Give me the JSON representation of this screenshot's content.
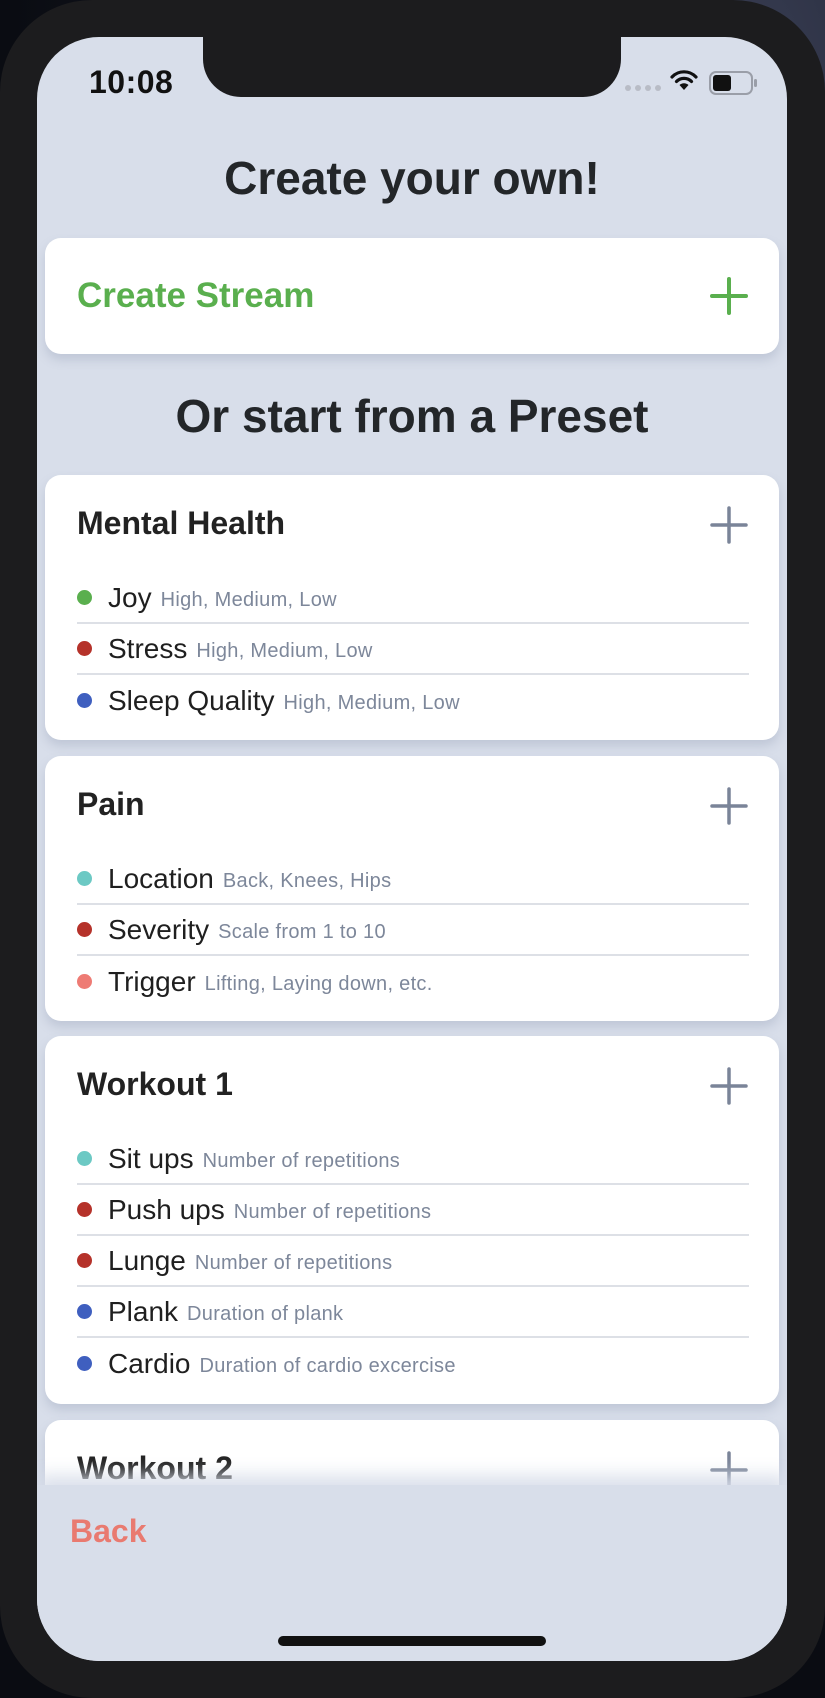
{
  "status_bar": {
    "time": "10:08"
  },
  "header": {
    "title": "Create your own!"
  },
  "create_stream": {
    "label": "Create Stream"
  },
  "presets_heading": "Or start from a Preset",
  "colors": {
    "green": "#5aaf4e",
    "red": "#b5322a",
    "blue": "#3f5fbf",
    "teal": "#6cc9c4",
    "salmon": "#ee7b74",
    "plus_gray": "#7a8498",
    "back_red": "#e97a70"
  },
  "presets": [
    {
      "title": "Mental Health",
      "items": [
        {
          "name": "Joy",
          "desc": "High, Medium, Low",
          "color": "#5aaf4e"
        },
        {
          "name": "Stress",
          "desc": "High, Medium, Low",
          "color": "#b5322a"
        },
        {
          "name": "Sleep Quality",
          "desc": "High, Medium, Low",
          "color": "#3f5fbf"
        }
      ]
    },
    {
      "title": "Pain",
      "items": [
        {
          "name": "Location",
          "desc": "Back, Knees, Hips",
          "color": "#6cc9c4"
        },
        {
          "name": "Severity",
          "desc": "Scale from 1 to 10",
          "color": "#b5322a"
        },
        {
          "name": "Trigger",
          "desc": "Lifting, Laying down, etc.",
          "color": "#ee7b74"
        }
      ]
    },
    {
      "title": "Workout 1",
      "items": [
        {
          "name": "Sit ups",
          "desc": "Number of repetitions",
          "color": "#6cc9c4"
        },
        {
          "name": "Push ups",
          "desc": "Number of repetitions",
          "color": "#b5322a"
        },
        {
          "name": "Lunge",
          "desc": "Number of repetitions",
          "color": "#b5322a"
        },
        {
          "name": "Plank",
          "desc": "Duration of plank",
          "color": "#3f5fbf"
        },
        {
          "name": "Cardio",
          "desc": "Duration of cardio excercise",
          "color": "#3f5fbf"
        }
      ]
    },
    {
      "title": "Workout 2",
      "items": []
    }
  ],
  "footer": {
    "back_label": "Back"
  }
}
